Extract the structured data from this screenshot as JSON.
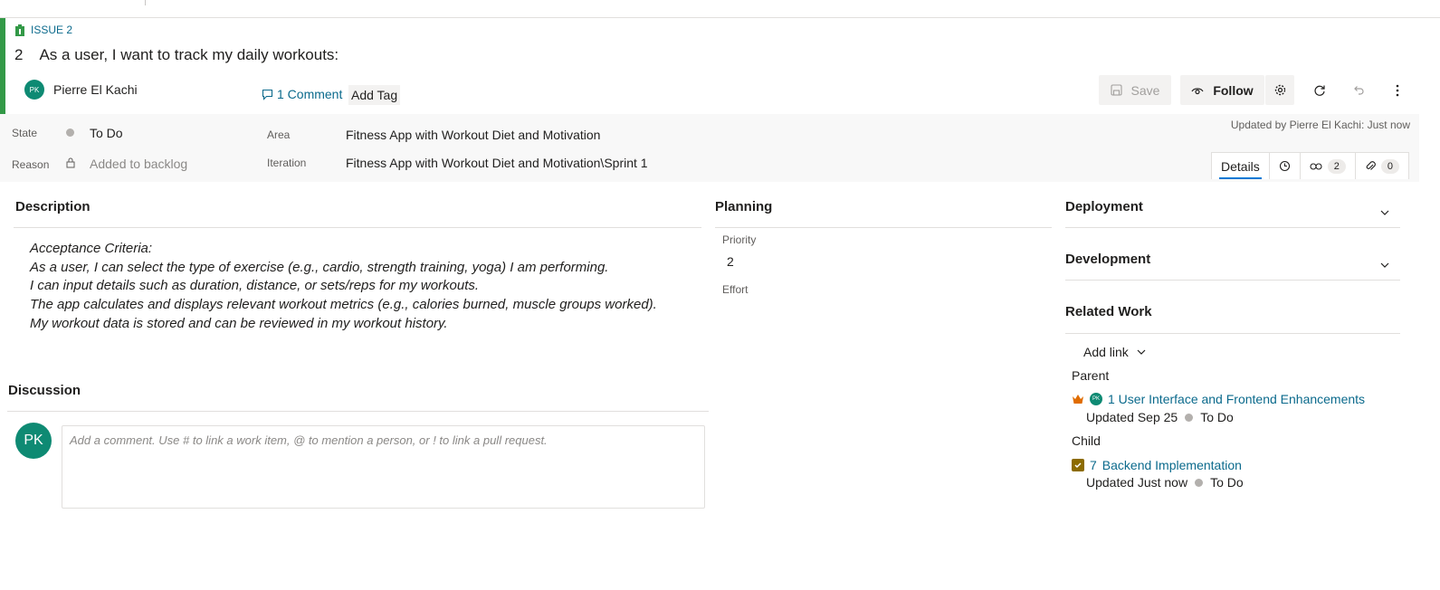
{
  "work_item": {
    "type_label": "ISSUE 2",
    "id": "2",
    "title": "As a user, I want to track my daily workouts:",
    "owner": {
      "name": "Pierre El Kachi",
      "initials": "PK"
    },
    "comment_link": "1 Comment",
    "add_tag": "Add Tag"
  },
  "toolbar": {
    "save_label": "Save",
    "follow_label": "Follow"
  },
  "fields": {
    "state_label": "State",
    "state_value": "To Do",
    "reason_label": "Reason",
    "reason_value": "Added to backlog",
    "area_label": "Area",
    "area_value": "Fitness App with Workout Diet and Motivation",
    "iteration_label": "Iteration",
    "iteration_value": "Fitness App with Workout Diet and Motivation\\Sprint 1",
    "updated_by": "Updated by Pierre El Kachi: Just now"
  },
  "tabs": {
    "details": "Details",
    "links_count": "2",
    "attachments_count": "0"
  },
  "description": {
    "title": "Description",
    "lines": [
      "Acceptance Criteria:",
      "As a user, I can select the type of exercise (e.g., cardio, strength training, yoga) I am performing.",
      "I can input details such as duration, distance, or sets/reps for my workouts.",
      "The app calculates and displays relevant workout metrics (e.g., calories burned, muscle groups worked).",
      "My workout data is stored and can be reviewed in my workout history."
    ]
  },
  "discussion": {
    "title": "Discussion",
    "avatar_initials": "PK",
    "placeholder": "Add a comment. Use # to link a work item, @ to mention a person, or ! to link a pull request."
  },
  "planning": {
    "title": "Planning",
    "priority_label": "Priority",
    "priority_value": "2",
    "effort_label": "Effort"
  },
  "deployment": {
    "title": "Deployment"
  },
  "development": {
    "title": "Development"
  },
  "related_work": {
    "title": "Related Work",
    "add_link": "Add link",
    "parent_label": "Parent",
    "parent": {
      "initials": "PK",
      "id_title": "1 User Interface and Frontend Enhancements",
      "updated": "Updated Sep 25",
      "state": "To Do"
    },
    "child_label": "Child",
    "child": {
      "id": "7",
      "title": "Backend Implementation",
      "updated": "Updated Just now",
      "state": "To Do"
    }
  },
  "colors": {
    "accent_green": "#339947",
    "link_blue": "#0b6a8c",
    "avatar_teal": "#0e8a73",
    "epic_orange": "#e06c00",
    "task_olive": "#8c6b00"
  }
}
